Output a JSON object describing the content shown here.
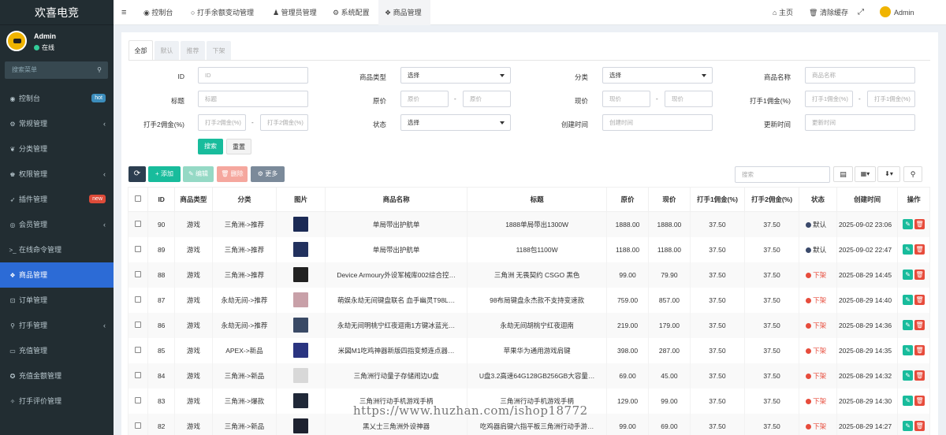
{
  "app": {
    "title": "欢喜电竞"
  },
  "user": {
    "name": "Admin",
    "status": "在线"
  },
  "sidebar": {
    "search_placeholder": "搜索菜单",
    "items": [
      {
        "label": "控制台",
        "icon": "dashboard-icon",
        "badge": "hot",
        "badge_color": "#3c8dbc"
      },
      {
        "label": "常规管理",
        "icon": "cogs-icon",
        "arrow": "‹"
      },
      {
        "label": "分类管理",
        "icon": "leaf-icon"
      },
      {
        "label": "权限管理",
        "icon": "group-icon",
        "arrow": "‹"
      },
      {
        "label": "插件管理",
        "icon": "rocket-icon",
        "badge": "new",
        "badge_color": "#dd4b39"
      },
      {
        "label": "会员管理",
        "icon": "user-circle-icon",
        "arrow": "‹"
      },
      {
        "label": "在线命令管理",
        "icon": "terminal-icon"
      },
      {
        "label": "商品管理",
        "icon": "cubes-icon",
        "active": true
      },
      {
        "label": "订单管理",
        "icon": "cart-icon"
      },
      {
        "label": "打手管理",
        "icon": "pin-icon",
        "arrow": "‹"
      },
      {
        "label": "充值管理",
        "icon": "card-icon"
      },
      {
        "label": "充值金额管理",
        "icon": "money-icon"
      },
      {
        "label": "打手评价管理",
        "icon": "star-circle-icon"
      }
    ]
  },
  "topnav": {
    "menu_icon": "≡",
    "tabs": [
      {
        "label": "控制台",
        "icon": "dashboard-icon"
      },
      {
        "label": "打手余额变动管理",
        "icon": "circle-icon"
      },
      {
        "label": "管理员管理",
        "icon": "user-icon"
      },
      {
        "label": "系统配置",
        "icon": "gear-icon"
      },
      {
        "label": "商品管理",
        "icon": "cubes-icon",
        "active": true
      }
    ],
    "right": {
      "home": "主页",
      "clear_cache": "清除缓存",
      "user": "Admin"
    }
  },
  "filter_tabs": [
    "全部",
    "默认",
    "推荐",
    "下架"
  ],
  "filters": {
    "id": {
      "label": "ID",
      "placeholder": "ID"
    },
    "type": {
      "label": "商品类型",
      "value": "选择"
    },
    "category": {
      "label": "分类",
      "value": "选择"
    },
    "name": {
      "label": "商品名称",
      "placeholder": "商品名称"
    },
    "title": {
      "label": "标题",
      "placeholder": "标题"
    },
    "orig_price": {
      "label": "原价",
      "placeholder": "原价"
    },
    "price": {
      "label": "现价",
      "placeholder": "现价"
    },
    "comm1": {
      "label": "打手1佣金(%)",
      "placeholder": "打手1佣金(%)"
    },
    "comm2": {
      "label": "打手2佣金(%)",
      "placeholder": "打手2佣金(%)"
    },
    "status": {
      "label": "状态",
      "value": "选择"
    },
    "created": {
      "label": "创建时间",
      "placeholder": "创建时间"
    },
    "updated": {
      "label": "更新时间",
      "placeholder": "更新时间"
    },
    "range_sep": "-",
    "search_btn": "搜索",
    "reset_btn": "重置"
  },
  "toolbar": {
    "refresh": "⟳",
    "add": "+ 添加",
    "edit": "✎ 编辑",
    "delete": "🗑 删除",
    "more": "⚙ 更多",
    "search_placeholder": "搜索"
  },
  "table": {
    "headers": [
      "",
      "ID",
      "商品类型",
      "分类",
      "图片",
      "商品名称",
      "标题",
      "原价",
      "现价",
      "打手1佣金(%)",
      "打手2佣金(%)",
      "状态",
      "创建时间",
      "操作"
    ],
    "rows": [
      {
        "id": "90",
        "type": "游戏",
        "category": "三角洲->推荐",
        "name": "单局带出护航单",
        "title": "1888单局带出1300W",
        "orig": "1888.00",
        "price": "1888.00",
        "c1": "37.50",
        "c2": "37.50",
        "status": "默认",
        "status_color": "#3b4a6b",
        "created": "2025-09-02 23:06",
        "thumb": "#1b2a55"
      },
      {
        "id": "89",
        "type": "游戏",
        "category": "三角洲->推荐",
        "name": "单局带出护航单",
        "title": "1188包1100W",
        "orig": "1188.00",
        "price": "1188.00",
        "c1": "37.50",
        "c2": "37.50",
        "status": "默认",
        "status_color": "#3b4a6b",
        "created": "2025-09-02 22:47",
        "thumb": "#22315e"
      },
      {
        "id": "88",
        "type": "游戏",
        "category": "三角洲->推荐",
        "name": "Device Armoury外设军械库002综合控…",
        "title": "三角洲 无畏契约 CSGO 黑色",
        "orig": "99.00",
        "price": "79.90",
        "c1": "37.50",
        "c2": "37.50",
        "status": "下架",
        "status_color": "#e74c3c",
        "created": "2025-08-29 14:45",
        "thumb": "#222"
      },
      {
        "id": "87",
        "type": "游戏",
        "category": "永劫无间->推荐",
        "name": "萌娱永劫无间键盘联名 血手幽灵T98L…",
        "title": "98布局键盘永杰款不支持变速款",
        "orig": "759.00",
        "price": "857.00",
        "c1": "37.50",
        "c2": "37.50",
        "status": "下架",
        "status_color": "#e74c3c",
        "created": "2025-08-29 14:40",
        "thumb": "#c8a0a8"
      },
      {
        "id": "86",
        "type": "游戏",
        "category": "永劫无间->推荐",
        "name": "永劫无间明桃宁红夜迴南1方键冰蓝光…",
        "title": "永劫无间胡桃宁红夜迴南",
        "orig": "219.00",
        "price": "179.00",
        "c1": "37.50",
        "c2": "37.50",
        "status": "下架",
        "status_color": "#e74c3c",
        "created": "2025-08-29 14:36",
        "thumb": "#3a4a66"
      },
      {
        "id": "85",
        "type": "游戏",
        "category": "APEX->新品",
        "name": "米図M1吃鸡神器新版四指变频连点器…",
        "title": "苹果华为通用游戏肩键",
        "orig": "398.00",
        "price": "287.00",
        "c1": "37.50",
        "c2": "37.50",
        "status": "下架",
        "status_color": "#e74c3c",
        "created": "2025-08-29 14:35",
        "thumb": "#2a3480"
      },
      {
        "id": "84",
        "type": "游戏",
        "category": "三角洲->新品",
        "name": "三角洲行动量子存储闹边U盘",
        "title": "U盘3.2高速64G128GB256GB大容量…",
        "orig": "69.00",
        "price": "45.00",
        "c1": "37.50",
        "c2": "37.50",
        "status": "下架",
        "status_color": "#e74c3c",
        "created": "2025-08-29 14:32",
        "thumb": "#d8d8d8"
      },
      {
        "id": "83",
        "type": "游戏",
        "category": "三角洲->爆款",
        "name": "三角洲行动手机游戏手柄",
        "title": "三角洲行动手机游戏手柄",
        "orig": "129.00",
        "price": "99.00",
        "c1": "37.50",
        "c2": "37.50",
        "status": "下架",
        "status_color": "#e74c3c",
        "created": "2025-08-29 14:30",
        "thumb": "#202838"
      },
      {
        "id": "82",
        "type": "游戏",
        "category": "三角洲->新品",
        "name": "黑乂士三角洲外设神器",
        "title": "吃鸡器肩键六指平板三角洲行动手游…",
        "orig": "99.00",
        "price": "69.00",
        "c1": "37.50",
        "c2": "37.50",
        "status": "下架",
        "status_color": "#e74c3c",
        "created": "2025-08-29 14:27",
        "thumb": "#1e2230"
      }
    ]
  },
  "watermark": "https://www.huzhan.com/ishop18772"
}
